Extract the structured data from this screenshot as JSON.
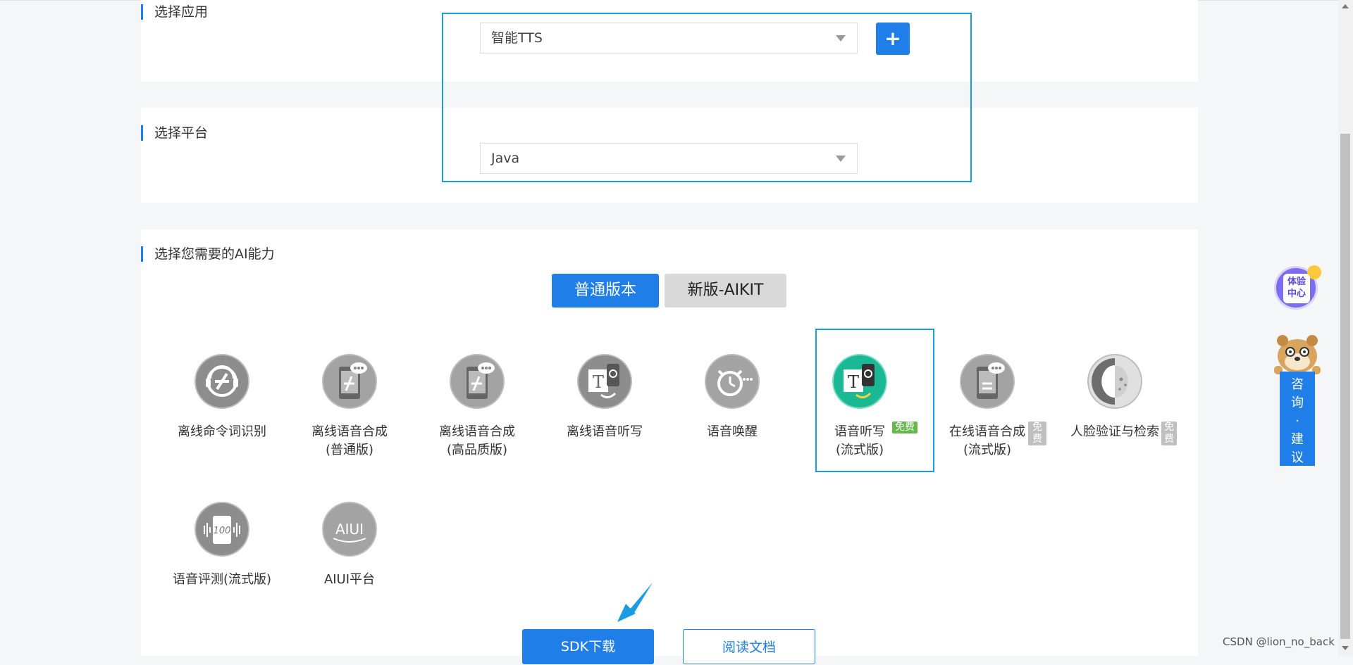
{
  "section_app": {
    "title": "选择应用",
    "selected_value": "智能TTS",
    "add_button_label": "+"
  },
  "section_platform": {
    "title": "选择平台",
    "selected_value": "Java"
  },
  "section_ai": {
    "title": "选择您需要的AI能力",
    "tabs": [
      {
        "label": "普通版本",
        "active": true
      },
      {
        "label": "新版-AIKIT",
        "active": false
      }
    ],
    "items": [
      {
        "line1": "离线命令词识别",
        "line2": "",
        "icon": "offline-command-icon"
      },
      {
        "line1": "离线语音合成",
        "line2": "(普通版)",
        "icon": "offline-tts-icon"
      },
      {
        "line1": "离线语音合成",
        "line2": "(高品质版)",
        "icon": "offline-tts-hq-icon"
      },
      {
        "line1": "离线语音听写",
        "line2": "",
        "icon": "offline-dictation-icon"
      },
      {
        "line1": "语音唤醒",
        "line2": "",
        "icon": "voice-wakeup-icon"
      },
      {
        "line1": "语音听写",
        "line2": "(流式版)",
        "icon": "dictation-stream-icon",
        "badge": "免费",
        "selected": true
      },
      {
        "line1": "在线语音合成",
        "line2": "(流式版)",
        "icon": "online-tts-stream-icon",
        "badge": "免费"
      },
      {
        "line1": "人脸验证与检索",
        "line2": "",
        "icon": "face-verify-icon",
        "badge": "免费"
      },
      {
        "line1": "语音评测(流式版)",
        "line2": "",
        "icon": "speech-eval-icon"
      },
      {
        "line1": "AIUI平台",
        "line2": "",
        "icon": "aiui-platform-icon"
      }
    ]
  },
  "actions": {
    "sdk_download": "SDK下载",
    "read_docs": "阅读文档"
  },
  "float_widgets": {
    "experience_line1": "体验",
    "experience_line2": "中心",
    "consult_text": [
      "咨",
      "询",
      "·",
      "建",
      "议"
    ]
  },
  "watermark": "CSDN @lion_no_back",
  "colors": {
    "accent": "#1f7ee8",
    "highlight_frame": "#1b9ce0",
    "badge_free": "#66b84e",
    "badge_free_inactive": "#bfbfbf",
    "icon_gray": "#8d8d8d",
    "icon_active": "#1ab894"
  }
}
